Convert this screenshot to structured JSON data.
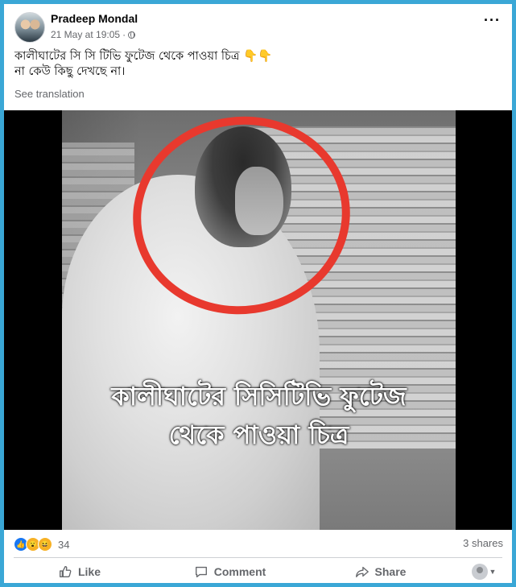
{
  "post": {
    "author": "Pradeep Mondal",
    "timestamp": "21 May at 19:05",
    "text_line1": "কালীঘাটের সি সি টিভি ফুটেজ থেকে পাওয়া চিত্র",
    "text_emoji": "👇👇",
    "text_line2": "না কেউ কিছু দেখছে না।",
    "see_translation": "See translation",
    "image_caption_line1": "কালীঘাটের সিসিটিভি ফুটেজ",
    "image_caption_line2": "থেকে পাওয়া চিত্র"
  },
  "stats": {
    "reaction_count": "34",
    "shares": "3 shares",
    "reaction_icons": [
      "like-icon",
      "wow-icon",
      "haha-icon"
    ]
  },
  "actions": {
    "like": "Like",
    "comment": "Comment",
    "share": "Share"
  },
  "icons": {
    "more": "more-options-icon",
    "privacy": "globe-icon"
  },
  "colors": {
    "frame": "#3aa7d6",
    "like_blue": "#1877f2",
    "highlight_red": "#e8392e"
  }
}
